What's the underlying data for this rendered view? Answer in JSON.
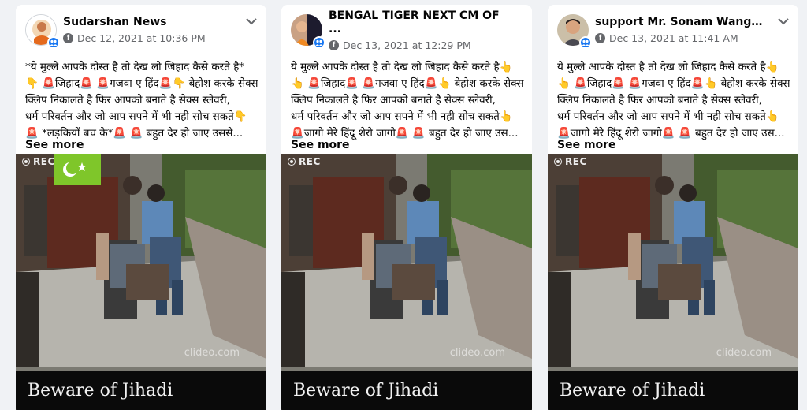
{
  "posts": [
    {
      "author": "Sudarshan News",
      "timestamp": "Dec 12, 2021 at 10:36 PM",
      "lines": [
        "*ये मुल्ले आपके दोस्त है तो देख लो जिहाद कैसे करते है*",
        "👇 🚨जिहाद🚨 🚨गजवा ए हिंद🚨👇 बेहोश करके सेक्स",
        "क्लिप निकालते है फिर आपको बनाते है सेक्स स्लेवरी,",
        "धर्म परिवर्तन और जो आप सपने में भी नही सोच सकते👇",
        "🚨 *लड़कियों बच के*🚨 🚨 बहुत देर हो जाए उससे..."
      ],
      "see_more": "See more",
      "rec_label": "REC",
      "watermark": "clideo.com",
      "caption": "Beware of Jihadi",
      "has_flag": true
    },
    {
      "author": "BENGAL TIGER NEXT CM OF ...",
      "timestamp": "Dec 13, 2021 at 12:29 PM",
      "lines": [
        "ये मुल्ले आपके दोस्त है तो देख लो जिहाद कैसे करते है👆",
        "👆 🚨जिहाद🚨 🚨गजवा ए हिंद🚨👆 बेहोश करके सेक्स",
        "क्लिप निकालते है फिर आपको बनाते है सेक्स स्लेवरी,",
        "धर्म परिवर्तन और जो आप सपने में भी नही सोच सकते👆",
        "🚨जागो मेरे हिंदू शेरो जागो🚨 🚨 बहुत देर हो जाए उस..."
      ],
      "see_more": "See more",
      "rec_label": "REC",
      "watermark": "clideo.com",
      "caption": "Beware of Jihadi",
      "has_flag": false
    },
    {
      "author": "support Mr. Sonam Wangch...",
      "timestamp": "Dec 13, 2021 at 11:41 AM",
      "lines": [
        "ये मुल्ले आपके दोस्त है तो देख लो जिहाद कैसे करते है👆",
        "👆 🚨जिहाद🚨 🚨गजवा ए हिंद🚨👆 बेहोश करके सेक्स",
        "क्लिप निकालते है फिर आपको बनाते है सेक्स स्लेवरी,",
        "धर्म परिवर्तन और जो आप सपने में भी नही सोच सकते👆",
        "🚨जागो मेरे हिंदू शेरो जागो🚨 🚨 बहुत देर हो जाए उस..."
      ],
      "see_more": "See more",
      "rec_label": "REC",
      "watermark": "clideo.com",
      "caption": "Beware of Jihadi",
      "has_flag": false
    }
  ],
  "colors": {
    "page_bg": "#f0f2f5",
    "card_bg": "#ffffff",
    "meta_text": "#65676b",
    "badge_blue": "#1877f2",
    "flag_green": "#7fc62a",
    "caption_bar": "#0a0a0a"
  },
  "icons": [
    "globe-icon",
    "chevron-down-icon",
    "group-badge-icon",
    "rec-icon"
  ]
}
